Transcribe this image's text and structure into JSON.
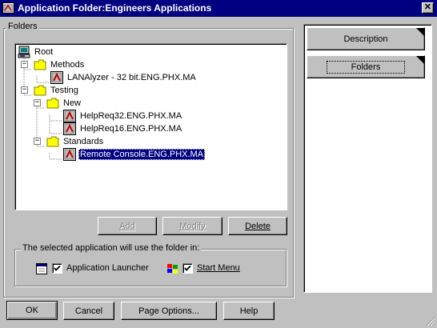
{
  "window": {
    "title": "Application Folder:Engineers Applications",
    "icon": "app-folder-icon",
    "close": "✕"
  },
  "folders_group": {
    "label": "Folders"
  },
  "tree": {
    "nodes": [
      {
        "label": "Root",
        "icon": "root-computer-icon",
        "level": 0,
        "expander": "",
        "selected": false
      },
      {
        "label": "Methods",
        "icon": "folder-icon",
        "level": 1,
        "expander": "−",
        "selected": false
      },
      {
        "label": "LANAlyzer - 32 bit.ENG.PHX.MA",
        "icon": "application-icon",
        "level": 2,
        "expander": "",
        "selected": false
      },
      {
        "label": "Testing",
        "icon": "folder-icon",
        "level": 1,
        "expander": "−",
        "selected": false
      },
      {
        "label": "New",
        "icon": "folder-icon",
        "level": 2,
        "expander": "−",
        "selected": false
      },
      {
        "label": "HelpReq32.ENG.PHX.MA",
        "icon": "application-icon",
        "level": 3,
        "expander": "",
        "selected": false
      },
      {
        "label": "HelpReq16.ENG.PHX.MA",
        "icon": "application-icon",
        "level": 3,
        "expander": "",
        "selected": false
      },
      {
        "label": "Standards",
        "icon": "folder-icon",
        "level": 2,
        "expander": "−",
        "selected": false
      },
      {
        "label": "Remote Console.ENG.PHX.MA",
        "icon": "application-icon",
        "level": 3,
        "expander": "",
        "selected": true
      }
    ]
  },
  "tree_buttons": {
    "add": {
      "label": "Add",
      "enabled": false
    },
    "modify": {
      "label": "Modify",
      "enabled": false
    },
    "delete": {
      "label": "Delete",
      "enabled": true
    }
  },
  "usage_group": {
    "label": "The selected application will use the folder in:",
    "launcher": {
      "label": "Application Launcher",
      "checked": true,
      "icon": "launcher-window-icon"
    },
    "start_menu": {
      "label": "Start Menu",
      "checked": true,
      "icon": "start-menu-flag-icon"
    }
  },
  "side_tabs": [
    {
      "label": "Description"
    },
    {
      "label": "Folders"
    }
  ],
  "footer": {
    "ok": "OK",
    "cancel": "Cancel",
    "page_options": "Page Options...",
    "help": "Help"
  },
  "colors": {
    "titlebar": "#000080",
    "face": "#c0c0c0",
    "selection": "#000080",
    "folder": "#ffff00",
    "app_icon_red": "#c00000"
  }
}
